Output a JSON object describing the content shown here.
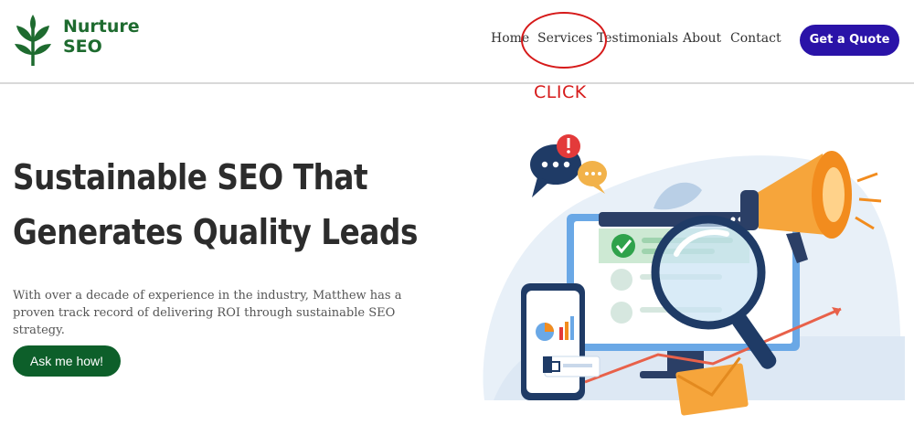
{
  "brand": {
    "line1": "Nurture",
    "line2": "SEO"
  },
  "nav": {
    "home": "Home",
    "services": "Services",
    "testimonials": "Testimonials",
    "about": "About",
    "contact": "Contact"
  },
  "header": {
    "quote_label": "Get a Quote"
  },
  "annotation": {
    "label": "CLICK"
  },
  "hero": {
    "title_line1": "Sustainable SEO That",
    "title_line2": "Generates Quality Leads",
    "description": "With over a decade of experience in the industry, Matthew has a proven track record of delivering ROI through sustainable SEO strategy.",
    "cta_label": "Ask me how!"
  },
  "colors": {
    "brand_green": "#1e6b2f",
    "cta_green": "#0d5f2a",
    "quote_purple": "#2a13a8",
    "annotation_red": "#d61a1a"
  }
}
